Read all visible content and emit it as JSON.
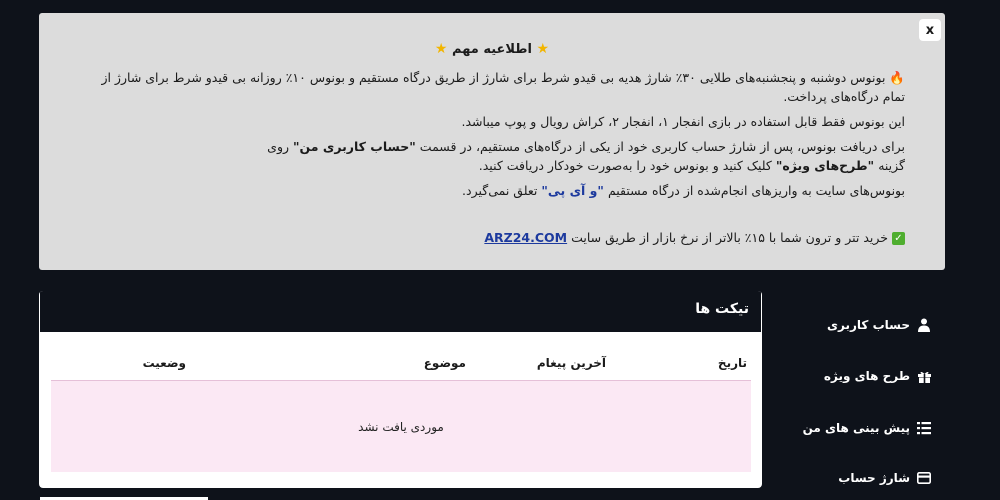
{
  "notice": {
    "close_label": "x",
    "title": "اطلاعیه مهم",
    "line1": "بونوس دوشنبه و پنجشنبه‌های طلایی ۳۰٪ شارژ هدیه بی قیدو شرط برای شارژ از طریق درگاه مستقیم و بونوس ۱۰٪ روزانه بی قیدو شرط برای شارژ از تمام درگاه‌های پرداخت.",
    "line2": "این بونوس فقط قابل استفاده در بازی انفجار ۱، انفجار ۲، کراش رویال و پوپ میباشد.",
    "line3_a": "برای دریافت بونوس، پس از شارژ حساب کاربری خود از یکی از درگاه‌های مستقیم، در قسمت",
    "line3_b": "\"حساب کاربری من\"",
    "line3_c": "روی گزینه",
    "line3_d": "\"طرح‌های ویژه\"",
    "line3_e": "کلیک کنید و بونوس خود را به‌صورت خودکار دریافت کنید.",
    "line4_a": "بونوس‌های سایت به واریزهای انجام‌شده از درگاه مستقیم",
    "line4_b": "\"و آی پی\"",
    "line4_c": "تعلق نمی‌گیرد.",
    "line5": "خرید تتر و ترون شما با ۱۵٪ بالاتر از نرخ بازار از طریق سایت",
    "link": "ARZ24.COM"
  },
  "tickets": {
    "title": "تیکت ها",
    "columns": [
      "تاریخ",
      "آخرین پیغام",
      "موضوع",
      "وضعیت"
    ],
    "empty": "موردی یافت نشد"
  },
  "sidebar": {
    "items": [
      {
        "label": "حساب کاربری",
        "icon": "user-icon"
      },
      {
        "label": "طرح های ویژه",
        "icon": "gift-icon"
      },
      {
        "label": "پیش بینی های من",
        "icon": "list-icon"
      },
      {
        "label": "شارژ حساب",
        "icon": "card-icon"
      }
    ]
  }
}
